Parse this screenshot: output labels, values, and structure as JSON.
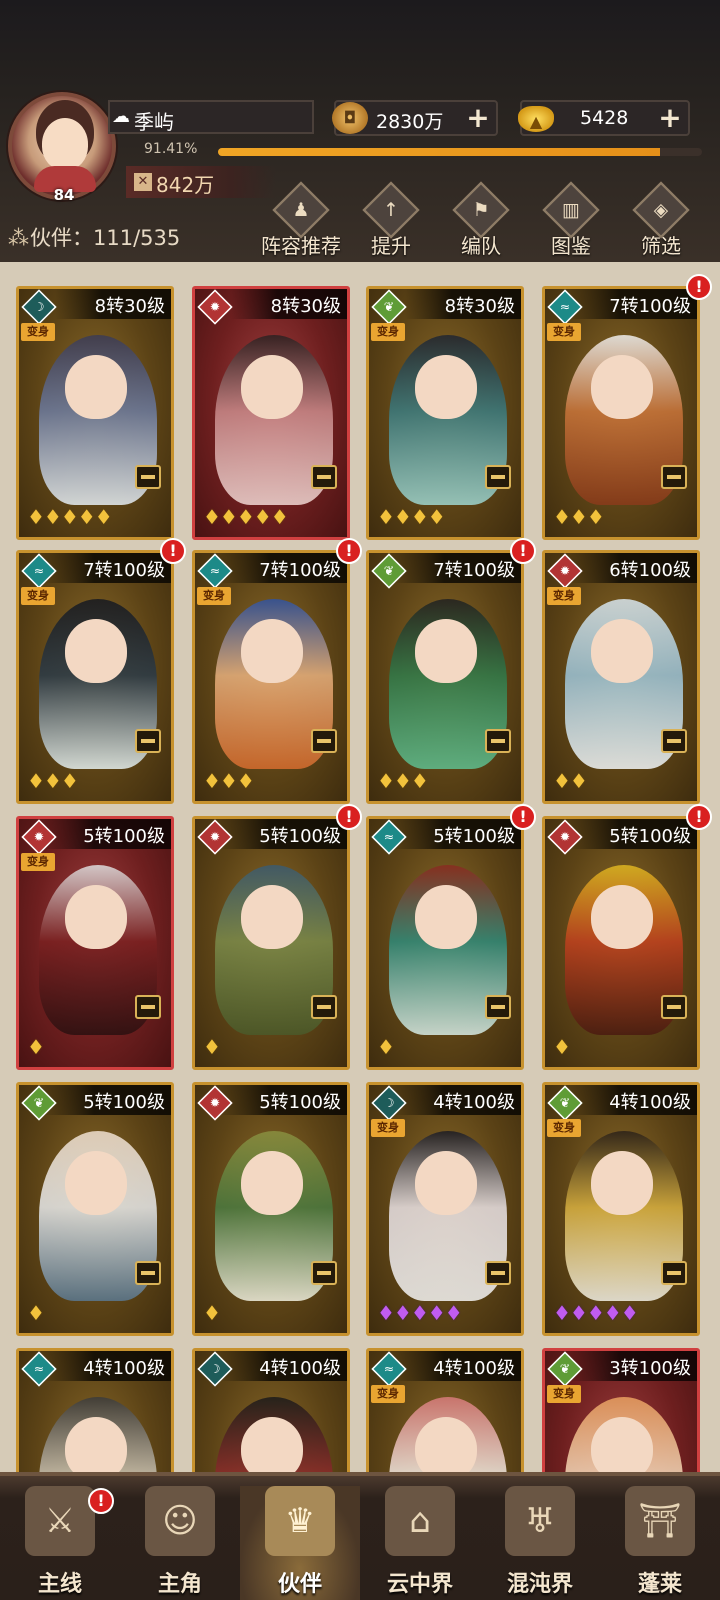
{
  "player": {
    "name": "季屿",
    "level": "84",
    "exp_percent": "91.41%",
    "exp_fraction": 0.9141,
    "power": "842万"
  },
  "resources": {
    "copper": "2830万",
    "gold": "5428"
  },
  "partners": {
    "label": "伙伴：111/535"
  },
  "menu": [
    {
      "label": "阵容推荐",
      "icon": "lineup-icon"
    },
    {
      "label": "提升",
      "icon": "upgrade-icon"
    },
    {
      "label": "编队",
      "icon": "formation-icon"
    },
    {
      "label": "图鉴",
      "icon": "codex-icon"
    },
    {
      "label": "筛选",
      "icon": "filter-icon"
    }
  ],
  "transform_label": "变身",
  "cards": [
    {
      "level": "8转30级",
      "element": "dark",
      "transform": true,
      "alert": false,
      "stars": 5,
      "star_color": "gold",
      "red": false,
      "art": [
        "#3a3a54",
        "#6c7ba0",
        "#e6eef4"
      ]
    },
    {
      "level": "8转30级",
      "element": "fire",
      "transform": false,
      "alert": false,
      "stars": 5,
      "star_color": "gold",
      "red": true,
      "art": [
        "#2a2020",
        "#c98a8a",
        "#f1d8d4"
      ]
    },
    {
      "level": "8转30级",
      "element": "wind",
      "transform": true,
      "alert": false,
      "stars": 4,
      "star_color": "gold",
      "red": false,
      "art": [
        "#1f2430",
        "#3a7b80",
        "#9fd6d0"
      ]
    },
    {
      "level": "7转100级",
      "element": "water",
      "transform": true,
      "alert": true,
      "stars": 3,
      "star_color": "gold",
      "red": false,
      "art": [
        "#f0f0f0",
        "#c9743a",
        "#8a3a1a"
      ]
    },
    {
      "level": "7转100级",
      "element": "water",
      "transform": true,
      "alert": true,
      "stars": 3,
      "star_color": "gold",
      "red": false,
      "art": [
        "#151820",
        "#2a3a48",
        "#e6f1f1"
      ]
    },
    {
      "level": "7转100级",
      "element": "water",
      "transform": true,
      "alert": true,
      "stars": 3,
      "star_color": "gold",
      "red": false,
      "art": [
        "#2f52a0",
        "#e7b07e",
        "#d66c2e"
      ]
    },
    {
      "level": "7转100级",
      "element": "wind",
      "transform": false,
      "alert": true,
      "stars": 3,
      "star_color": "gold",
      "red": false,
      "art": [
        "#202020",
        "#2f7a4a",
        "#5fbf90"
      ]
    },
    {
      "level": "6转100级",
      "element": "fire",
      "transform": true,
      "alert": false,
      "stars": 2,
      "star_color": "gold",
      "red": false,
      "art": [
        "#d9e6ee",
        "#9cc4d8",
        "#f2f6f8"
      ]
    },
    {
      "level": "5转100级",
      "element": "fire",
      "transform": true,
      "alert": false,
      "stars": 1,
      "star_color": "gold",
      "red": true,
      "art": [
        "#e0e0e0",
        "#7a2020",
        "#2a1010"
      ]
    },
    {
      "level": "5转100级",
      "element": "fire",
      "transform": false,
      "alert": true,
      "stars": 1,
      "star_color": "gold",
      "red": false,
      "art": [
        "#3a5a70",
        "#7a8a4a",
        "#4a5a2a"
      ]
    },
    {
      "level": "5转100级",
      "element": "water",
      "transform": false,
      "alert": true,
      "stars": 1,
      "star_color": "gold",
      "red": false,
      "art": [
        "#8a2a20",
        "#2e8a7a",
        "#d8ece6"
      ]
    },
    {
      "level": "5转100级",
      "element": "fire",
      "transform": false,
      "alert": true,
      "stars": 1,
      "star_color": "gold",
      "red": false,
      "art": [
        "#e0b820",
        "#c0401e",
        "#4a1a10"
      ]
    },
    {
      "level": "5转100级",
      "element": "wind",
      "transform": false,
      "alert": false,
      "stars": 1,
      "star_color": "gold",
      "red": false,
      "art": [
        "#f0e0d0",
        "#e8eaec",
        "#5a7890"
      ]
    },
    {
      "level": "5转100级",
      "element": "fire",
      "transform": false,
      "alert": false,
      "stars": 1,
      "star_color": "gold",
      "red": false,
      "art": [
        "#8a9040",
        "#4a7a40",
        "#f0f0e0"
      ]
    },
    {
      "level": "4转100级",
      "element": "dark",
      "transform": true,
      "alert": false,
      "stars": 5,
      "star_color": "purple",
      "red": false,
      "art": [
        "#1a1a22",
        "#e9e2e6",
        "#f4f4f4"
      ]
    },
    {
      "level": "4转100级",
      "element": "wind",
      "transform": true,
      "alert": false,
      "stars": 5,
      "star_color": "purple",
      "red": false,
      "art": [
        "#2a2018",
        "#d8b040",
        "#f2f0e6"
      ]
    },
    {
      "level": "4转100级",
      "element": "water",
      "transform": false,
      "alert": false,
      "stars": 0,
      "star_color": "gold",
      "red": false,
      "art": [
        "#3a3a3a",
        "#c8c0b0",
        "#6a5a40"
      ]
    },
    {
      "level": "4转100级",
      "element": "dark",
      "transform": false,
      "alert": false,
      "stars": 0,
      "star_color": "gold",
      "red": false,
      "art": [
        "#1a1a1a",
        "#8a2a2a",
        "#3a2a2a"
      ]
    },
    {
      "level": "4转100级",
      "element": "water",
      "transform": true,
      "alert": false,
      "stars": 0,
      "star_color": "gold",
      "red": false,
      "art": [
        "#d87a7a",
        "#f2e8e0",
        "#3a2a2a"
      ]
    },
    {
      "level": "3转100级",
      "element": "wind",
      "transform": true,
      "alert": false,
      "stars": 0,
      "star_color": "gold",
      "red": true,
      "art": [
        "#e9a060",
        "#f4d8b8",
        "#c04030"
      ]
    }
  ],
  "nav": [
    {
      "label": "主线",
      "icon": "crossed-swords-icon",
      "active": false,
      "alert": true
    },
    {
      "label": "主角",
      "icon": "hero-icon",
      "active": false,
      "alert": false
    },
    {
      "label": "伙伴",
      "icon": "partner-crown-icon",
      "active": true,
      "alert": false
    },
    {
      "label": "云中界",
      "icon": "pagoda-icon",
      "active": false,
      "alert": false
    },
    {
      "label": "混沌界",
      "icon": "chaos-icon",
      "active": false,
      "alert": false
    },
    {
      "label": "蓬莱",
      "icon": "penglai-icon",
      "active": false,
      "alert": false
    }
  ]
}
